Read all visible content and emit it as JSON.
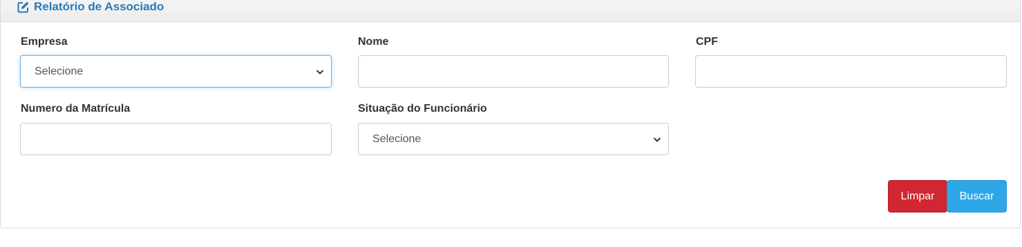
{
  "panel": {
    "title": "Relatório de Associado",
    "icon": "edit-icon"
  },
  "form": {
    "empresa": {
      "label": "Empresa",
      "selected": "Selecione"
    },
    "nome": {
      "label": "Nome",
      "value": ""
    },
    "cpf": {
      "label": "CPF",
      "value": ""
    },
    "matricula": {
      "label": "Numero da Matrícula",
      "value": ""
    },
    "situacao": {
      "label": "Situação do Funcionário",
      "selected": "Selecione"
    }
  },
  "actions": {
    "limpar": "Limpar",
    "buscar": "Buscar"
  },
  "colors": {
    "title": "#2a7bb8",
    "limpar_bg": "#d22630",
    "buscar_bg": "#2ea7e8",
    "focus_border": "#66afe9"
  }
}
